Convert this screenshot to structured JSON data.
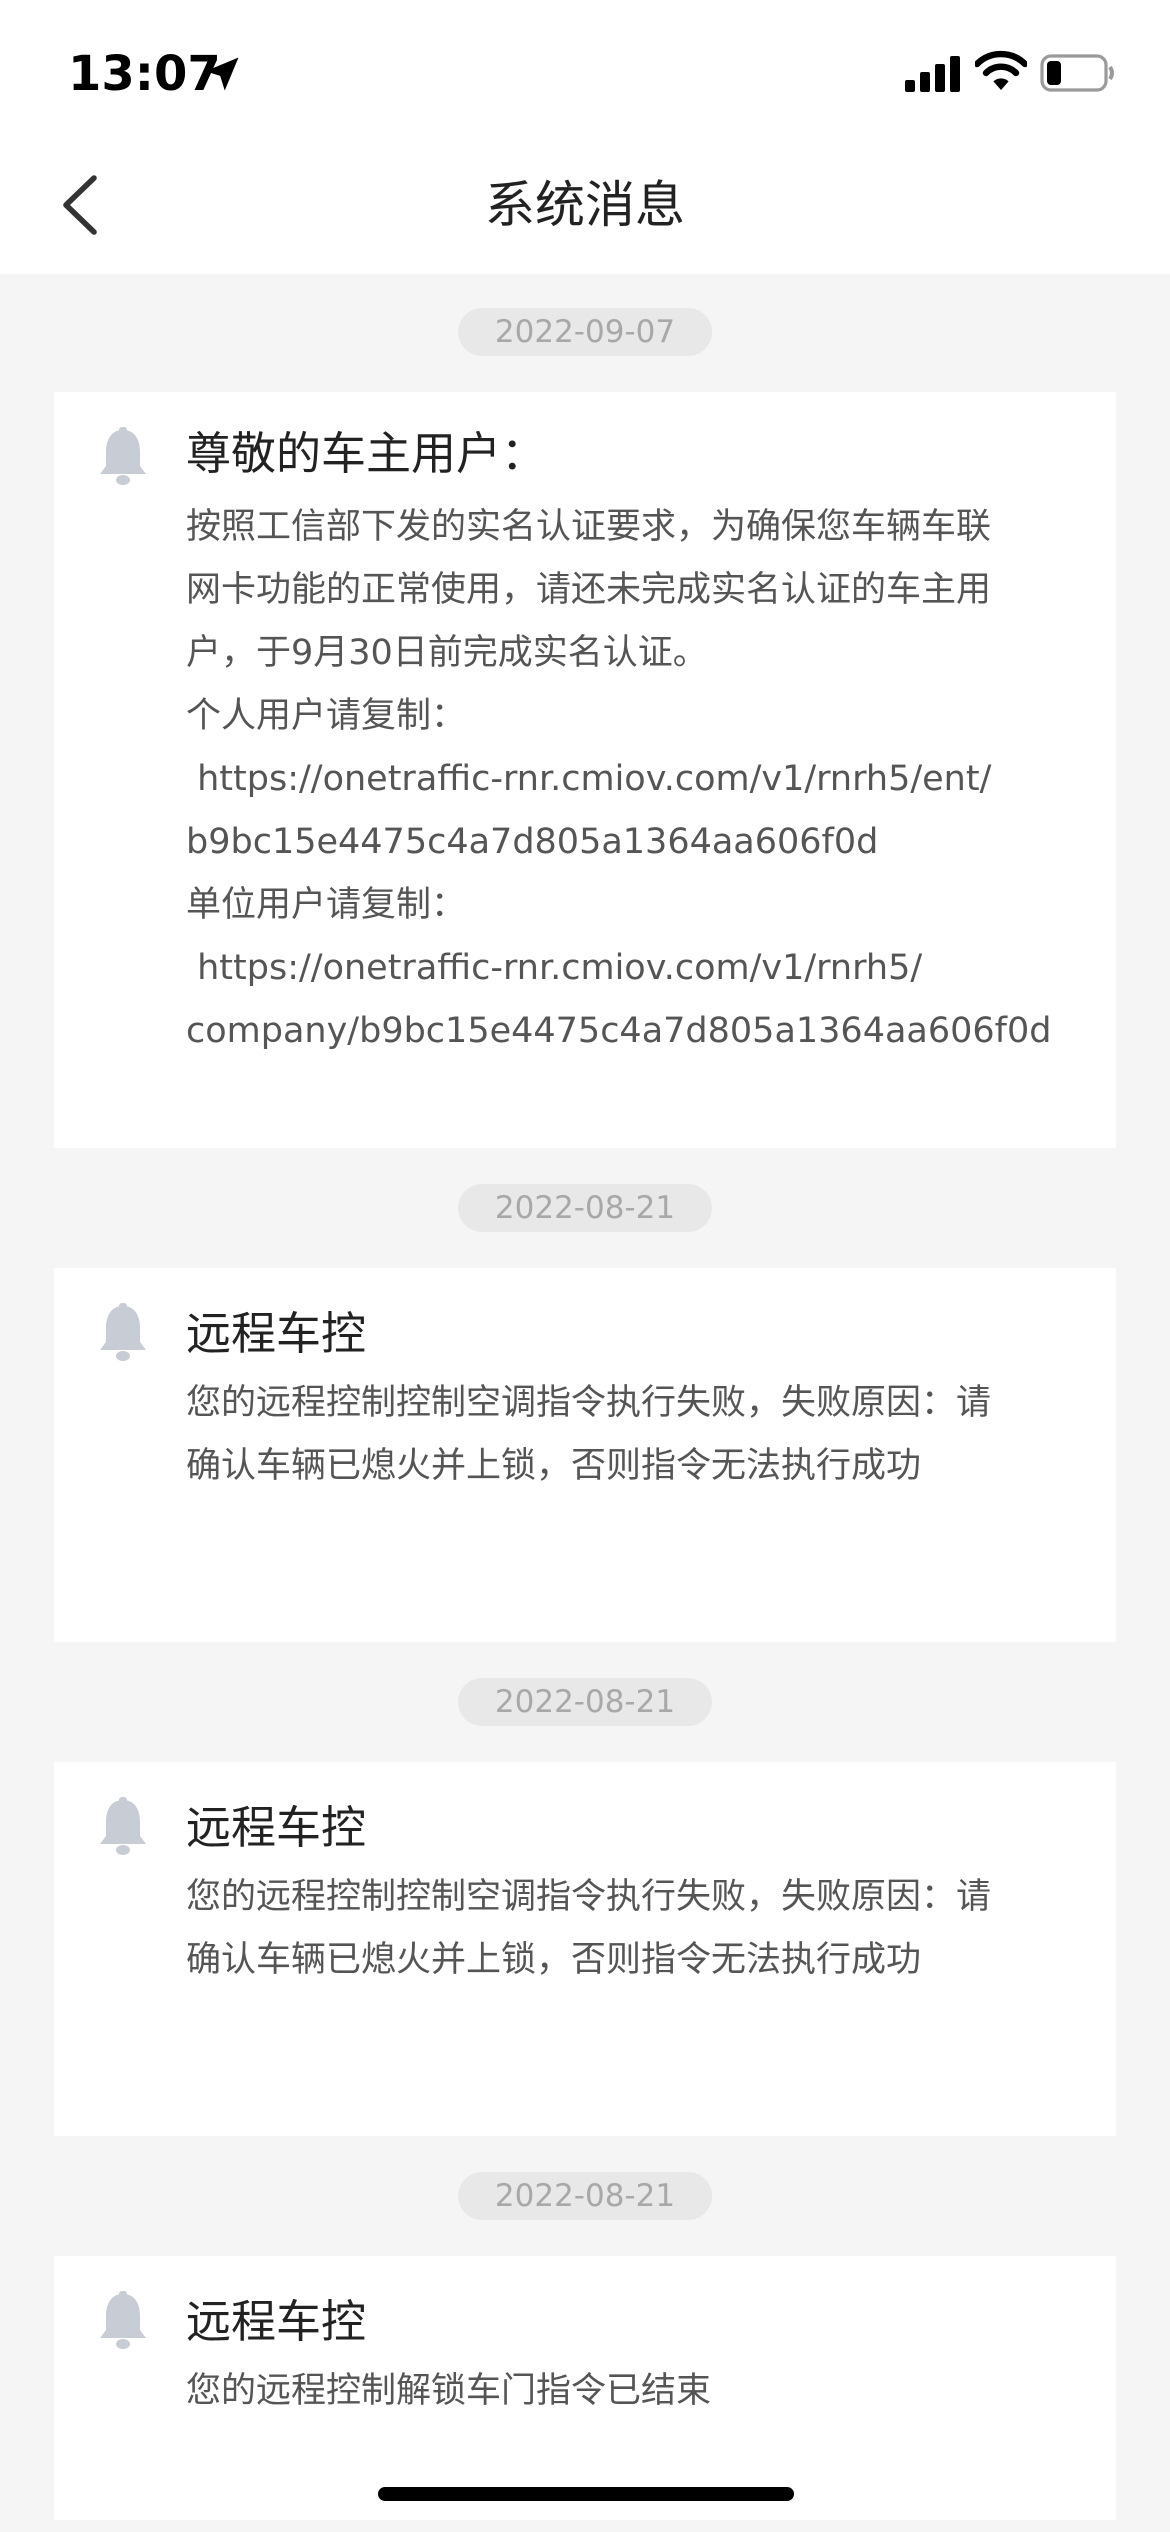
{
  "status_bar": {
    "time": "13:07",
    "location_icon": "location-arrow-icon",
    "signal_icon": "cellular-signal-icon",
    "wifi_icon": "wifi-icon",
    "battery_icon": "battery-low-icon"
  },
  "nav": {
    "back_icon": "chevron-left-icon",
    "title": "系统消息"
  },
  "messages": [
    {
      "date": "2022-09-07",
      "icon": "bell-icon",
      "title": "尊敬的车主用户：",
      "lines": [
        "按照工信部下发的实名认证要求，为确保您车辆车联",
        "网卡功能的正常使用，请还未完成实名认证的车主用",
        "户，于9月30日前完成实名认证。",
        "个人用户请复制：",
        " https://onetraffic-rnr.cmiov.com/v1/rnrh5/ent/",
        "b9bc15e4475c4a7d805a1364aa606f0d",
        "单位用户请复制：",
        " https://onetraffic-rnr.cmiov.com/v1/rnrh5/",
        "company/b9bc15e4475c4a7d805a1364aa606f0d"
      ]
    },
    {
      "date": "2022-08-21",
      "icon": "bell-icon",
      "title": "远程车控",
      "lines": [
        "您的远程控制控制空调指令执行失败，失败原因：请",
        "确认车辆已熄火并上锁，否则指令无法执行成功"
      ]
    },
    {
      "date": "2022-08-21",
      "icon": "bell-icon",
      "title": "远程车控",
      "lines": [
        "您的远程控制控制空调指令执行失败，失败原因：请",
        "确认车辆已熄火并上锁，否则指令无法执行成功"
      ]
    },
    {
      "date": "2022-08-21",
      "icon": "bell-icon",
      "title": "远程车控",
      "lines": [
        "您的远程控制解锁车门指令已结束"
      ]
    }
  ],
  "colors": {
    "background": "#f5f5f5",
    "card": "#ffffff",
    "date_pill": "#e8e8e8",
    "date_text": "#a8a8a8",
    "bell": "#c8ccd4",
    "title_text": "#222222",
    "body_text": "#555555"
  }
}
